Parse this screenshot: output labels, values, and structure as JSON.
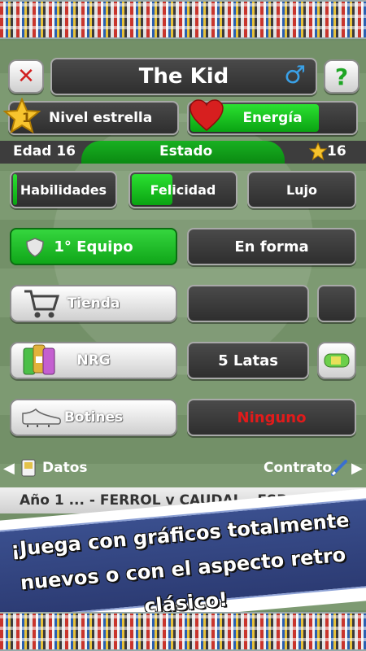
{
  "header": {
    "player_name": "The Kid",
    "gender_symbol": "♂",
    "help_symbol": "?",
    "close_symbol": "✕"
  },
  "stats": {
    "star_level": "1",
    "star_label": "Nivel estrella",
    "energy_label": "Energía",
    "energy_level": 0.78,
    "age_label": "Edad 16",
    "status_label": "Estado",
    "coins_value": "16"
  },
  "attributes": {
    "skills_label": "Habilidades",
    "skills_level": 0.04,
    "happiness_label": "Felicidad",
    "happiness_level": 0.4,
    "luxury_label": "Lujo"
  },
  "team": {
    "team_label": "1° Equipo",
    "form_label": "En forma"
  },
  "shop": {
    "shop_label": "Tienda"
  },
  "nrg": {
    "nrg_label": "NRG",
    "cans_label": "5 Latas"
  },
  "boots": {
    "boots_label": "Botines",
    "boots_value": "Ninguno"
  },
  "nav": {
    "left_label": "Datos",
    "right_label": "Contrato"
  },
  "ticker": {
    "text": "Año 1   ... - FERROL  v  CAUDAL - ESP"
  },
  "banner": {
    "line1": "¡Juega con gráficos totalmente",
    "line2": "nuevos o con el aspecto retro clásico!"
  },
  "colors": {
    "accent_green": "#18b021",
    "energy_red": "#d71f1f",
    "warning_red": "#e11b1b",
    "gender_blue": "#3aa0e6"
  }
}
